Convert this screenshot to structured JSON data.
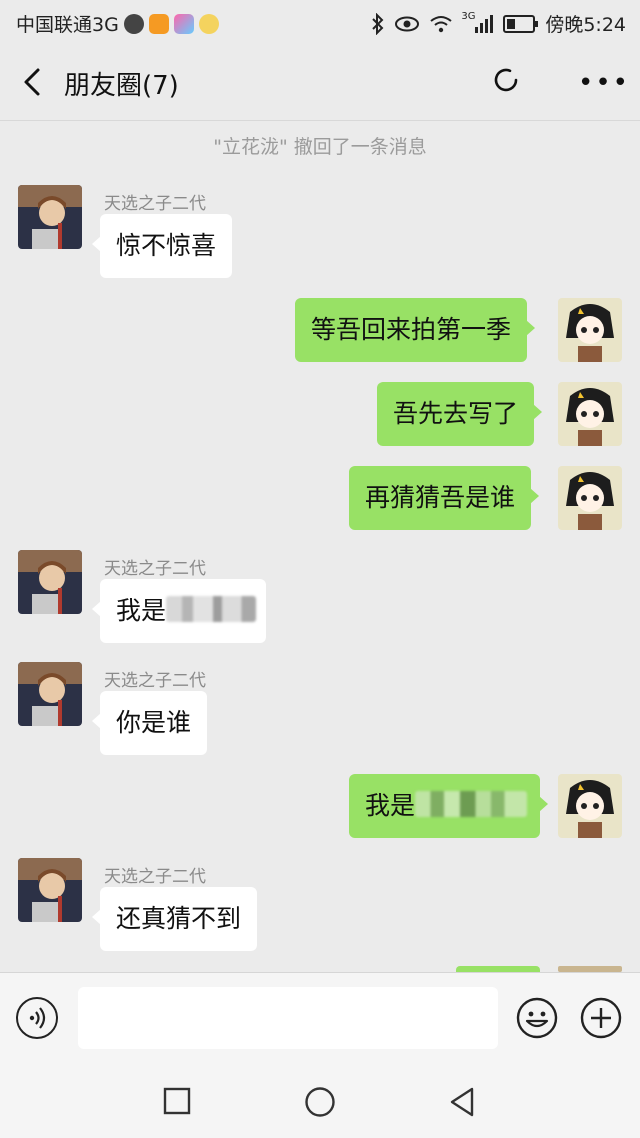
{
  "status_bar": {
    "carrier": "中国联通3G",
    "network_small": "3G",
    "time": "傍晚5:24"
  },
  "header": {
    "title": "朋友圈(7)"
  },
  "system_message": "\"立花泷\" 撤回了一条消息",
  "messages": [
    {
      "side": "in",
      "sender": "天选之子二代",
      "text": "惊不惊喜"
    },
    {
      "side": "out",
      "text": "等吾回来拍第一季"
    },
    {
      "side": "out",
      "text": "吾先去写了"
    },
    {
      "side": "out",
      "text": "再猜猜吾是谁"
    },
    {
      "side": "in",
      "sender": "天选之子二代",
      "text": "我是"
    },
    {
      "side": "in",
      "sender": "天选之子二代",
      "text": "你是谁"
    },
    {
      "side": "out",
      "text": "我是"
    },
    {
      "side": "in",
      "sender": "天选之子二代",
      "text": "还真猜不到"
    }
  ],
  "input": {
    "value": "",
    "placeholder": ""
  },
  "colors": {
    "background": "#ebebeb",
    "outgoing_bubble": "#98e165",
    "incoming_bubble": "#ffffff"
  },
  "icons": [
    "back-arrow-icon",
    "refresh-icon",
    "more-icon",
    "voice-icon",
    "emoji-icon",
    "plus-icon",
    "recent-apps-icon",
    "home-icon",
    "back-triangle-icon"
  ]
}
